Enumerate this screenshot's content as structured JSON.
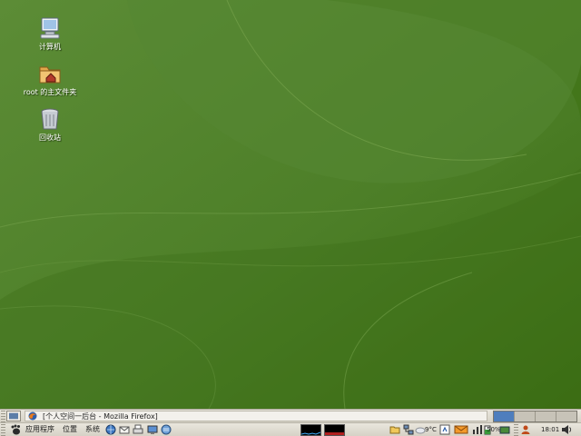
{
  "desktop": {
    "icons": [
      {
        "label": "计算机",
        "icon": "computer-icon"
      },
      {
        "label": "root 的主文件夹",
        "icon": "home-folder-icon"
      },
      {
        "label": "回收站",
        "icon": "trash-icon"
      }
    ]
  },
  "window_list": {
    "show_desktop_icon": "show-desktop-icon",
    "tasks": [
      {
        "label": "[个人空间一后台 - Mozilla Firefox]",
        "icon": "firefox-icon"
      }
    ]
  },
  "workspaces": {
    "count": 4,
    "active_index": 0
  },
  "main_panel": {
    "menus": {
      "applications": "应用程序",
      "places": "位置",
      "system": "系统"
    },
    "launchers": [
      "web-browser-icon",
      "email-icon",
      "printer-icon",
      "screen-icon",
      "network-icon"
    ]
  },
  "tray": {
    "temperature": "9°C",
    "battery_percent": "50%",
    "clock": "18:01",
    "icons": [
      "folder-icon",
      "network-tray-icon",
      "weather-icon",
      "update-icon",
      "mail-tray-icon",
      "chart-icon",
      "battery-icon",
      "keyboard-icon",
      "user-icon",
      "volume-icon"
    ]
  },
  "colors": {
    "wallpaper": "#4f7f2a",
    "panel": "#e2dfd6",
    "active_workspace": "#4f7ebd"
  }
}
